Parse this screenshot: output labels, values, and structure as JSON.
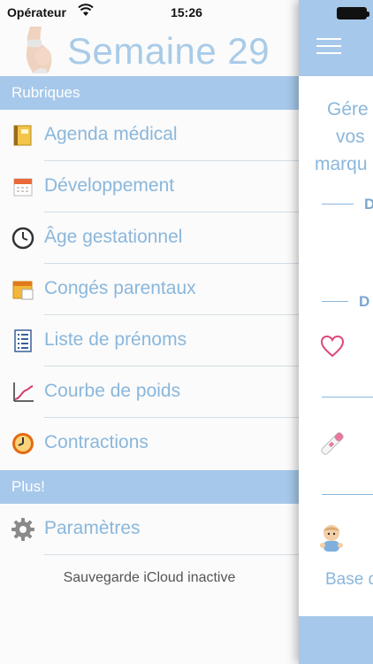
{
  "status_bar": {
    "carrier": "Opérateur",
    "time": "15:26"
  },
  "menu": {
    "title": "Semaine 29",
    "section_rubriques": "Rubriques",
    "items": [
      {
        "label": "Agenda médical",
        "icon": "agenda-icon"
      },
      {
        "label": "Développement",
        "icon": "calendar-icon"
      },
      {
        "label": "Âge gestationnel",
        "icon": "clock-icon"
      },
      {
        "label": "Congés parentaux",
        "icon": "calendar-24-icon"
      },
      {
        "label": "Liste de prénoms",
        "icon": "list-icon"
      },
      {
        "label": "Courbe de poids",
        "icon": "chart-icon"
      },
      {
        "label": "Contractions",
        "icon": "alarm-clock-icon"
      }
    ],
    "section_plus": "Plus!",
    "settings_label": "Paramètres",
    "footer": "Sauvegarde iCloud inactive"
  },
  "panel": {
    "text_line1": "Gére",
    "text_line2": "vos",
    "text_line3": "marqu",
    "letter1": "D",
    "letter2": "D",
    "bottom_text": "Base d"
  },
  "colors": {
    "accent": "#a6c8ea",
    "label": "#8ab7dc"
  }
}
